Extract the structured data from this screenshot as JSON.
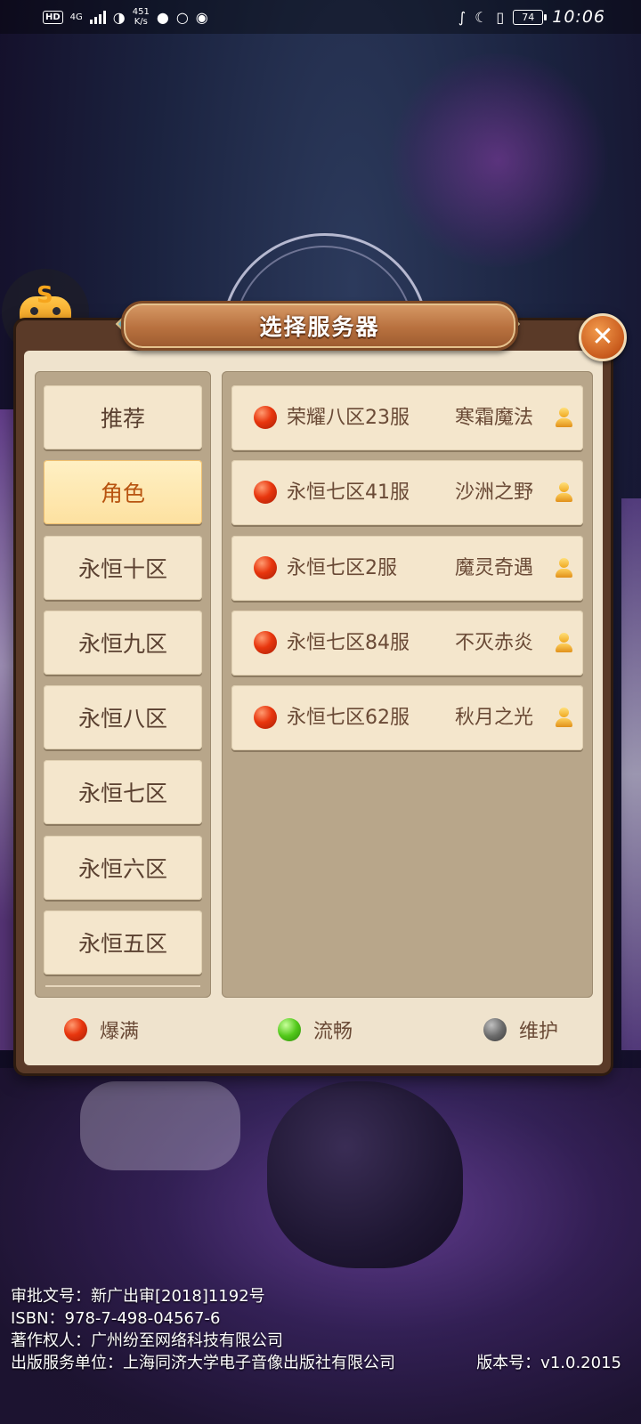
{
  "status_bar": {
    "hd_label": "HD",
    "network_label": "4G",
    "speed_value": "451",
    "speed_unit": "K/s",
    "battery_level": "74",
    "time": "10:06",
    "icons": [
      "signal-icon",
      "wifi-icon",
      "qq-icon",
      "wechat-icon",
      "message-icon",
      "bluetooth-icon",
      "moon-icon",
      "vibrate-icon",
      "battery-icon"
    ]
  },
  "dialog": {
    "title": "选择服务器",
    "close_icon": "close-icon"
  },
  "categories": [
    {
      "label": "推荐",
      "active": false
    },
    {
      "label": "角色",
      "active": true
    },
    {
      "label": "永恒十区",
      "active": false
    },
    {
      "label": "永恒九区",
      "active": false
    },
    {
      "label": "永恒八区",
      "active": false
    },
    {
      "label": "永恒七区",
      "active": false
    },
    {
      "label": "永恒六区",
      "active": false
    },
    {
      "label": "永恒五区",
      "active": false
    }
  ],
  "servers": [
    {
      "name": "荣耀八区23服",
      "title": "寒霜魔法",
      "status": "full"
    },
    {
      "name": "永恒七区41服",
      "title": "沙洲之野",
      "status": "full"
    },
    {
      "name": "永恒七区2服",
      "title": "魔灵奇遇",
      "status": "full"
    },
    {
      "name": "永恒七区84服",
      "title": "不灭赤炎",
      "status": "full"
    },
    {
      "name": "永恒七区62服",
      "title": "秋月之光",
      "status": "full"
    }
  ],
  "legend": [
    {
      "label": "爆满",
      "status": "full"
    },
    {
      "label": "流畅",
      "status": "smooth"
    },
    {
      "label": "维护",
      "status": "maintenance"
    }
  ],
  "colors": {
    "full": "#e8360e",
    "smooth": "#52c81a",
    "maintenance": "#6c6c6c",
    "active_category_text": "#b85410"
  },
  "footer": {
    "approval": "审批文号：新广出审[2018]1192号",
    "isbn": "ISBN：978-7-498-04567-6",
    "copyright": "著作权人：广州纷至网络科技有限公司",
    "publisher": "出版服务单位：上海同济大学电子音像出版社有限公司",
    "version": "版本号：v1.0.2015"
  }
}
